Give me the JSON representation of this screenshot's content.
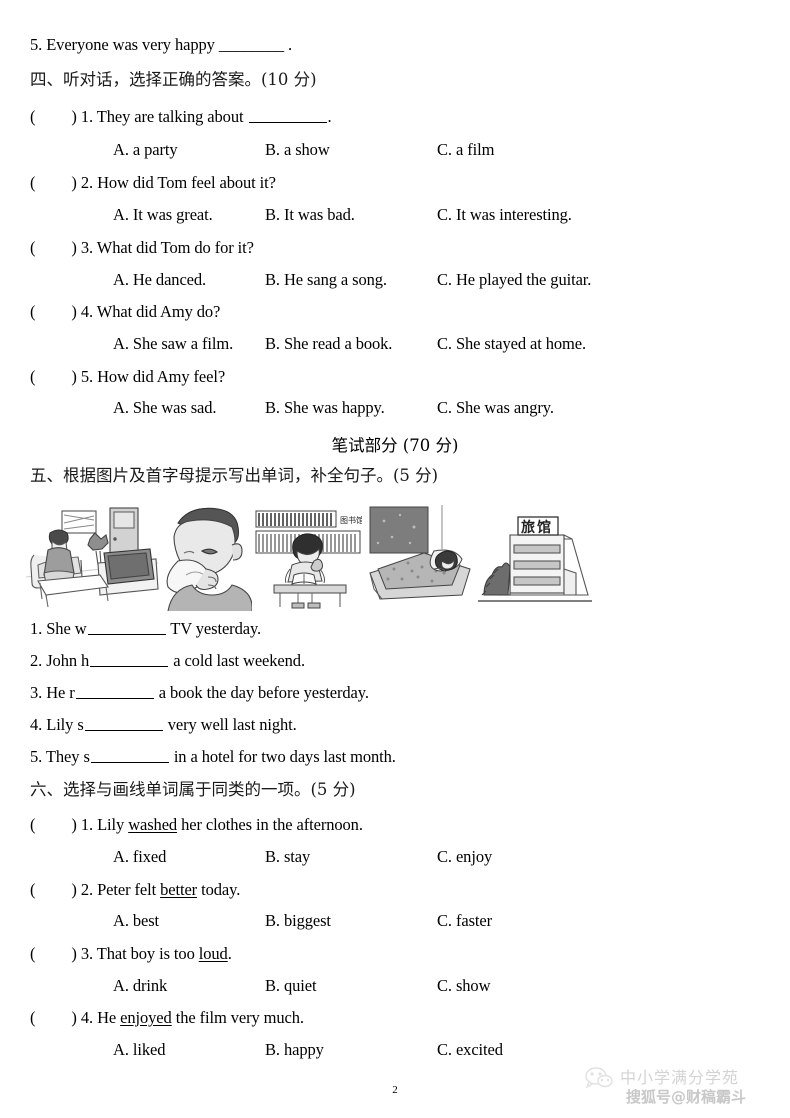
{
  "document": {
    "page_number": "2",
    "carryover_item": "5. Everyone was very happy ________ ."
  },
  "section_four": {
    "heading": "四、听对话，选择正确的答案。(10 分)",
    "questions": [
      {
        "marker": "(",
        "marker_close": ")",
        "number": "1.",
        "stem_before": "They are talking about",
        "stem_after": ".",
        "options": [
          "A. a party",
          "B. a show",
          "C. a film"
        ]
      },
      {
        "marker": "(",
        "marker_close": ")",
        "number": "2.",
        "stem": "How did Tom feel about it?",
        "options": [
          "A. It was great.",
          "B. It was bad.",
          "C. It was interesting."
        ]
      },
      {
        "marker": "(",
        "marker_close": ")",
        "number": "3.",
        "stem": "What did Tom do for it?",
        "options": [
          "A. He danced.",
          "B. He sang a song.",
          "C. He played the guitar."
        ]
      },
      {
        "marker": "(",
        "marker_close": ")",
        "number": "4.",
        "stem": "What did Amy do?",
        "options": [
          "A. She saw a film.",
          "B. She read a book.",
          "C. She stayed at home."
        ]
      },
      {
        "marker": "(",
        "marker_close": ")",
        "number": "5.",
        "stem": "How did Amy feel?",
        "options": [
          "A. She was sad.",
          "B. She was happy.",
          "C. She was angry."
        ]
      }
    ]
  },
  "written_part": {
    "title": "笔试部分 (70 分)"
  },
  "section_five": {
    "heading": "五、根据图片及首字母提示写出单词，补全句子。(5 分)",
    "illustrations": [
      {
        "name": "watching-tv-illustration",
        "caption": ""
      },
      {
        "name": "man-with-cold-illustration",
        "caption": ""
      },
      {
        "name": "boy-reading-in-library-illustration",
        "caption": "图书馆"
      },
      {
        "name": "girl-sleeping-in-bed-illustration",
        "caption": ""
      },
      {
        "name": "hotel-building-illustration",
        "caption": "旅馆"
      }
    ],
    "items": [
      {
        "number": "1.",
        "before": "She w",
        "after": "TV yesterday."
      },
      {
        "number": "2.",
        "before": "John h",
        "after": "a cold last weekend."
      },
      {
        "number": "3.",
        "before": "He r",
        "after": "a book the day before yesterday."
      },
      {
        "number": "4.",
        "before": "Lily s",
        "after": "very well last night."
      },
      {
        "number": "5.",
        "before": "They s",
        "after": "in a hotel for two days last month."
      }
    ]
  },
  "section_six": {
    "heading": "六、选择与画线单词属于同类的一项。(5 分)",
    "questions": [
      {
        "marker": "(",
        "marker_close": ")",
        "number": "1.",
        "stem_pre": "Lily ",
        "stem_underlined": "washed",
        "stem_post": " her clothes in the afternoon.",
        "options": [
          "A. fixed",
          "B. stay",
          "C. enjoy"
        ]
      },
      {
        "marker": "(",
        "marker_close": ")",
        "number": "2.",
        "stem_pre": "Peter felt ",
        "stem_underlined": "better",
        "stem_post": " today.",
        "options": [
          "A. best",
          "B. biggest",
          "C. faster"
        ]
      },
      {
        "marker": "(",
        "marker_close": ")",
        "number": "3.",
        "stem_pre": "That boy is too ",
        "stem_underlined": "loud",
        "stem_post": ".",
        "options": [
          "A. drink",
          "B. quiet",
          "C. show"
        ]
      },
      {
        "marker": "(",
        "marker_close": ")",
        "number": "4.",
        "stem_pre": "He ",
        "stem_underlined": "enjoyed",
        "stem_post": " the film very much.",
        "options": [
          "A. liked",
          "B. happy",
          "C. excited"
        ]
      }
    ]
  },
  "watermark": {
    "line1": "中小学满分学苑",
    "line2": "搜狐号@财稿霸斗"
  }
}
